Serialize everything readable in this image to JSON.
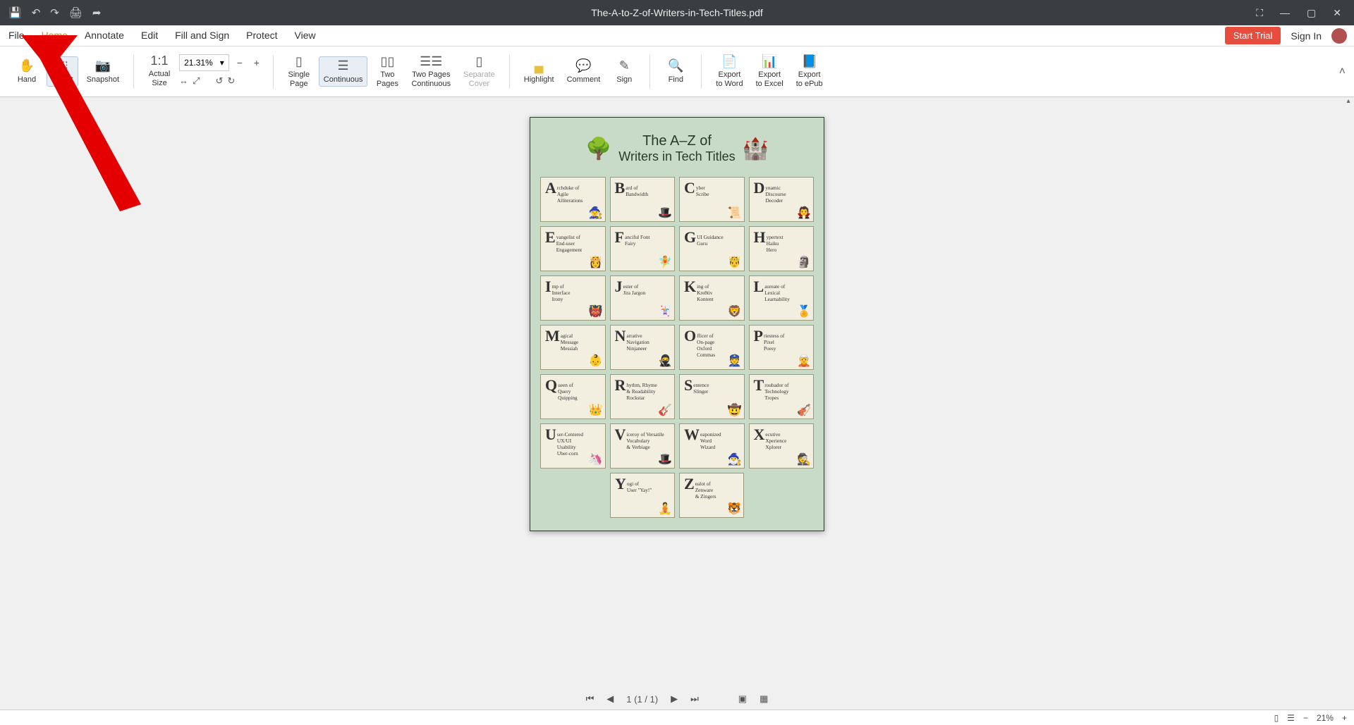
{
  "titlebar": {
    "doc_title": "The-A-to-Z-of-Writers-in-Tech-Titles.pdf"
  },
  "menus": {
    "file": "File",
    "home": "Home",
    "annotate": "Annotate",
    "edit": "Edit",
    "fillsign": "Fill and Sign",
    "protect": "Protect",
    "view": "View"
  },
  "header_right": {
    "start_trial": "Start Trial",
    "sign_in": "Sign In"
  },
  "ribbon": {
    "hand": "Hand",
    "select": "Select",
    "snapshot": "Snapshot",
    "actual_size": "Actual\nSize",
    "zoom_value": "21.31%",
    "single_page": "Single\nPage",
    "continuous": "Continuous",
    "two_pages": "Two\nPages",
    "two_pages_cont": "Two Pages\nContinuous",
    "separate_cover": "Separate\nCover",
    "highlight": "Highlight",
    "comment": "Comment",
    "sign": "Sign",
    "find": "Find",
    "export_word": "Export\nto Word",
    "export_excel": "Export\nto Excel",
    "export_epub": "Export\nto ePub"
  },
  "poster": {
    "title_l1": "The A–Z of",
    "title_l2": "Writers in Tech Titles",
    "cards": [
      {
        "letter": "A",
        "text": "rchduke of\nAgile\nAlliterations",
        "emoji": "🧙"
      },
      {
        "letter": "B",
        "text": "ard of\nBandwidth",
        "emoji": "🎩"
      },
      {
        "letter": "C",
        "text": "yber\nScribe",
        "emoji": "📜"
      },
      {
        "letter": "D",
        "text": "ynamic\nDiscourse\nDecoder",
        "emoji": "🧛"
      },
      {
        "letter": "E",
        "text": "vangelist of\nEnd-user\nEngagement",
        "emoji": "👸"
      },
      {
        "letter": "F",
        "text": "anciful Font\nFairy",
        "emoji": "🧚"
      },
      {
        "letter": "G",
        "text": "UI Guidance\nGuru",
        "emoji": "🤴"
      },
      {
        "letter": "H",
        "text": "ypertext\nHaiku\nHero",
        "emoji": "🗿"
      },
      {
        "letter": "I",
        "text": "mp of\nInterface\nIrony",
        "emoji": "👹"
      },
      {
        "letter": "J",
        "text": "ester of\nJira Jargon",
        "emoji": "🃏"
      },
      {
        "letter": "K",
        "text": "ing of\nKre8tiv\nKontent",
        "emoji": "🦁"
      },
      {
        "letter": "L",
        "text": "aureate of\nLexical\nLearnability",
        "emoji": "🏅"
      },
      {
        "letter": "M",
        "text": "agical\nMessage\nMessiah",
        "emoji": "👶"
      },
      {
        "letter": "N",
        "text": "arrative\nNavigation\nNinjaneer",
        "emoji": "🥷"
      },
      {
        "letter": "O",
        "text": "fficer of\nOn-page\nOxford\nCommas",
        "emoji": "👮"
      },
      {
        "letter": "P",
        "text": "riestess of\nPixel\nPoesy",
        "emoji": "🧝"
      },
      {
        "letter": "Q",
        "text": "ueen of\nQuery\nQuipping",
        "emoji": "👑"
      },
      {
        "letter": "R",
        "text": "hythm, Rhyme\n& Readability\nRockstar",
        "emoji": "🎸"
      },
      {
        "letter": "S",
        "text": "entence\nSlinger",
        "emoji": "🤠"
      },
      {
        "letter": "T",
        "text": "roubador of\nTechnology\nTropes",
        "emoji": "🎻"
      },
      {
        "letter": "U",
        "text": "ser-Centered\nUX/UI\nUsability\nUber-corn",
        "emoji": "🦄"
      },
      {
        "letter": "V",
        "text": "iceroy of Versatile\nVocabulary\n& Verbiage",
        "emoji": "🎩"
      },
      {
        "letter": "W",
        "text": "eaponized\nWord\nWizard",
        "emoji": "🧙‍♂️"
      },
      {
        "letter": "X",
        "text": "ecutive\nXperience\nXplorer",
        "emoji": "🕵️"
      }
    ],
    "last_row": [
      {
        "letter": "Y",
        "text": "ogi of\nUser \"Yay!\"",
        "emoji": "🧘"
      },
      {
        "letter": "Z",
        "text": "ealot of\nZenware\n& Zingers",
        "emoji": "🐯"
      }
    ]
  },
  "pagenav": {
    "indicator": "1 (1 / 1)"
  },
  "statusbar": {
    "zoom": "21%"
  }
}
